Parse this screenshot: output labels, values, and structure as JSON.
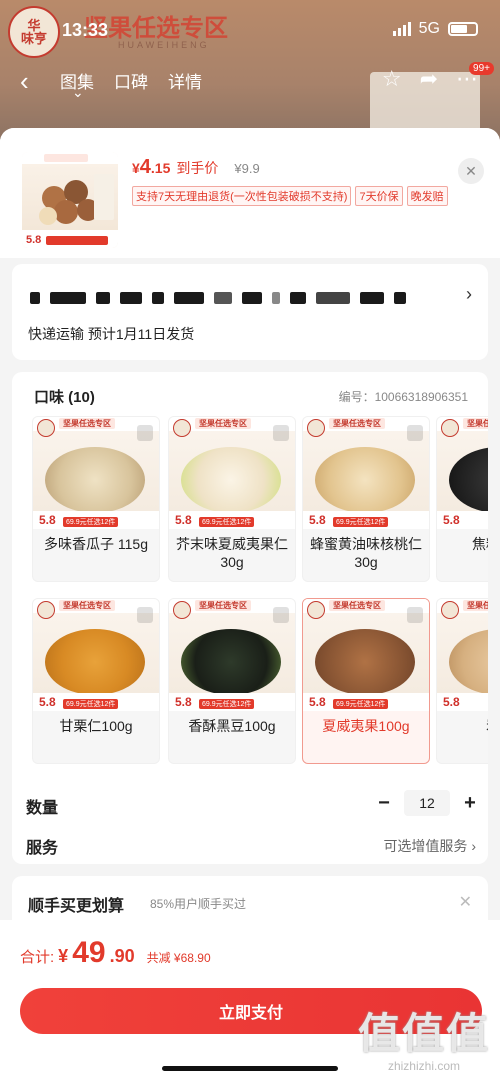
{
  "status": {
    "time": "13:33",
    "network": "5G"
  },
  "background": {
    "banner": "坚果任选专区",
    "subtitle": "HUAWEIHENG",
    "tabs": [
      "图集",
      "口碑",
      "详情"
    ],
    "badge": "99+"
  },
  "product": {
    "price_symbol": "¥",
    "price_int": "4",
    "price_dec": ".15",
    "price_label": "到手价",
    "original_price": "¥9.9",
    "tags": [
      "支持7天无理由退货(一次性包装破损不支持)",
      "7天价保",
      "晚发赔"
    ]
  },
  "shipping": {
    "text": "快递运输 预计1月11日发货"
  },
  "spec": {
    "title": "口味 (10)",
    "code": "编号：10066318906351",
    "options": [
      {
        "name": "多味香瓜子 115g",
        "selected": false
      },
      {
        "name": "芥末味夏威夷果仁30g",
        "selected": false
      },
      {
        "name": "蜂蜜黄油味核桃仁30g",
        "selected": false
      },
      {
        "name": "焦糖味瓜",
        "selected": false
      },
      {
        "name": "甘栗仁100g",
        "selected": false
      },
      {
        "name": "香酥黑豆100g",
        "selected": false
      },
      {
        "name": "夏威夷果100g",
        "selected": true
      },
      {
        "name": "炭烧",
        "selected": false
      }
    ],
    "thumb_price": "5.8",
    "thumb_promo": "69.9元任选12件",
    "thumb_header": "坚果任选专区"
  },
  "quantity": {
    "label": "数量",
    "value": "12",
    "minus": "−",
    "plus": "+"
  },
  "service": {
    "label": "服务",
    "value": "可选增值服务"
  },
  "upsell": {
    "title": "顺手买更划算",
    "subtitle": "85%用户顺手买过"
  },
  "checkout": {
    "label": "合计:",
    "currency": "¥",
    "amount_int": "49",
    "amount_dec": ".90",
    "saved": "共减 ¥68.90",
    "pay_button": "立即支付"
  },
  "watermark": {
    "big": "值值值",
    "small": "zhizhizhi.com"
  },
  "colors": {
    "accent": "#e23a2b",
    "button": "#ee3b37"
  }
}
